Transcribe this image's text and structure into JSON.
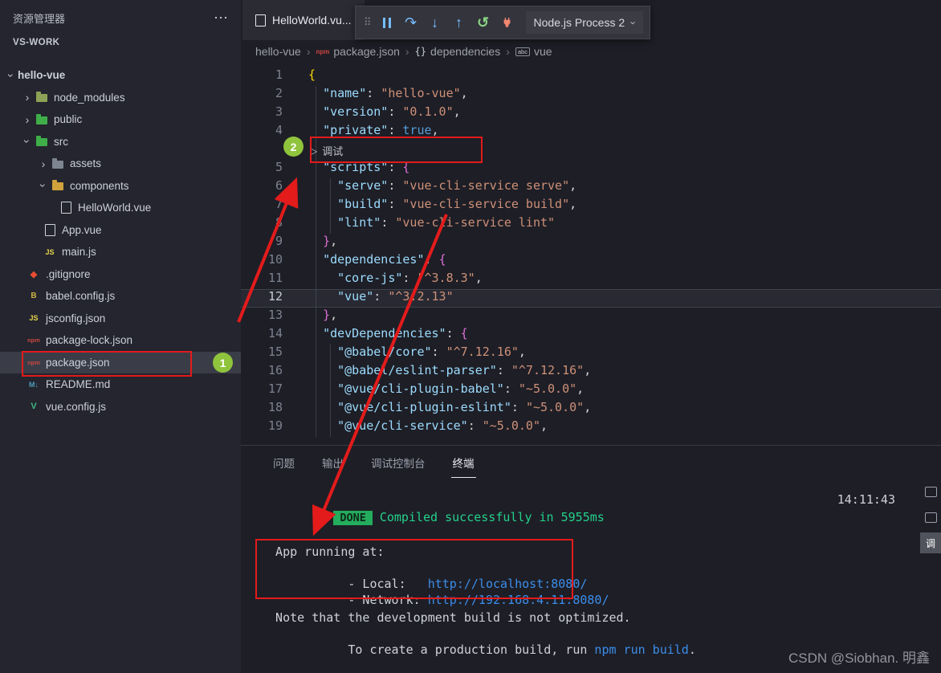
{
  "app": {
    "watermark": "CSDN @Siobhan. 明鑫"
  },
  "colors": {
    "annotationRed": "#e31b1b",
    "badgeGreen": "#8fc43c",
    "doneBg": "#23ad5c",
    "successGreen": "#23d18b",
    "linkBlue": "#3b8eea",
    "keyBlue": "#9cdcfe",
    "strOrange": "#ce9178",
    "kwBlue": "#569cd6",
    "braceGold": "#ffd700",
    "bracePurple": "#da70d6"
  },
  "sidebar": {
    "title": "资源管理器",
    "section": "VS-WORK",
    "tree": [
      {
        "label": "hello-vue",
        "level": 0,
        "chevron": "down"
      },
      {
        "label": "node_modules",
        "level": 1,
        "chevron": "right",
        "icon": "folder-nm"
      },
      {
        "label": "public",
        "level": 1,
        "chevron": "right",
        "icon": "folder-green"
      },
      {
        "label": "src",
        "level": 1,
        "chevron": "down",
        "icon": "folder-green"
      },
      {
        "label": "assets",
        "level": 2,
        "chevron": "right",
        "icon": "folder-gray"
      },
      {
        "label": "components",
        "level": 2,
        "chevron": "down",
        "icon": "folder-yellow"
      },
      {
        "label": "HelloWorld.vue",
        "level": 3,
        "icon": "page"
      },
      {
        "label": "App.vue",
        "level": 2,
        "icon": "page"
      },
      {
        "label": "main.js",
        "level": 2,
        "icon": "js"
      },
      {
        "label": ".gitignore",
        "level": 1,
        "icon": "git"
      },
      {
        "label": "babel.config.js",
        "level": 1,
        "icon": "babel"
      },
      {
        "label": "jsconfig.json",
        "level": 1,
        "icon": "js"
      },
      {
        "label": "package-lock.json",
        "level": 1,
        "icon": "npm"
      },
      {
        "label": "package.json",
        "level": 1,
        "icon": "npm",
        "selected": true
      },
      {
        "label": "README.md",
        "level": 1,
        "icon": "md"
      },
      {
        "label": "vue.config.js",
        "level": 1,
        "icon": "vue"
      }
    ]
  },
  "editor_tab": {
    "title": "HelloWorld.vu..."
  },
  "debug_toolbar": {
    "process_label": "Node.js Process 2",
    "icons": [
      "drag-handle",
      "pause",
      "step-over",
      "step-into",
      "step-out",
      "restart",
      "disconnect"
    ]
  },
  "breadcrumb": {
    "items": [
      {
        "label": "hello-vue"
      },
      {
        "label": "package.json",
        "icon": "npm"
      },
      {
        "label": "dependencies",
        "icon": "braces"
      },
      {
        "label": "vue",
        "icon": "abc"
      }
    ]
  },
  "editor": {
    "current_line": 12,
    "codelens": {
      "after_line": 4,
      "label": "调试"
    },
    "lines": [
      {
        "n": 1,
        "tokens": [
          [
            "{",
            "b1"
          ]
        ]
      },
      {
        "n": 2,
        "tokens": [
          [
            "  ",
            "p"
          ],
          [
            "\"name\"",
            "k"
          ],
          [
            ": ",
            "p"
          ],
          [
            "\"hello-vue\"",
            "s"
          ],
          [
            ",",
            "p"
          ]
        ]
      },
      {
        "n": 3,
        "tokens": [
          [
            "  ",
            "p"
          ],
          [
            "\"version\"",
            "k"
          ],
          [
            ": ",
            "p"
          ],
          [
            "\"0.1.0\"",
            "s"
          ],
          [
            ",",
            "p"
          ]
        ]
      },
      {
        "n": 4,
        "tokens": [
          [
            "  ",
            "p"
          ],
          [
            "\"private\"",
            "k"
          ],
          [
            ": ",
            "p"
          ],
          [
            "true",
            "w"
          ],
          [
            ",",
            "p"
          ]
        ]
      },
      {
        "n": 5,
        "tokens": [
          [
            "  ",
            "p"
          ],
          [
            "\"scripts\"",
            "k"
          ],
          [
            ": ",
            "p"
          ],
          [
            "{",
            "b2"
          ]
        ]
      },
      {
        "n": 6,
        "tokens": [
          [
            "    ",
            "p"
          ],
          [
            "\"serve\"",
            "k"
          ],
          [
            ": ",
            "p"
          ],
          [
            "\"vue-cli-service serve\"",
            "s"
          ],
          [
            ",",
            "p"
          ]
        ]
      },
      {
        "n": 7,
        "tokens": [
          [
            "    ",
            "p"
          ],
          [
            "\"build\"",
            "k"
          ],
          [
            ": ",
            "p"
          ],
          [
            "\"vue-cli-service build\"",
            "s"
          ],
          [
            ",",
            "p"
          ]
        ]
      },
      {
        "n": 8,
        "tokens": [
          [
            "    ",
            "p"
          ],
          [
            "\"lint\"",
            "k"
          ],
          [
            ": ",
            "p"
          ],
          [
            "\"vue-cli-service lint\"",
            "s"
          ]
        ]
      },
      {
        "n": 9,
        "tokens": [
          [
            "  ",
            "p"
          ],
          [
            "}",
            "b2"
          ],
          [
            ",",
            "p"
          ]
        ]
      },
      {
        "n": 10,
        "tokens": [
          [
            "  ",
            "p"
          ],
          [
            "\"dependencies\"",
            "k"
          ],
          [
            ": ",
            "p"
          ],
          [
            "{",
            "b2"
          ]
        ]
      },
      {
        "n": 11,
        "tokens": [
          [
            "    ",
            "p"
          ],
          [
            "\"core-js\"",
            "k"
          ],
          [
            ": ",
            "p"
          ],
          [
            "\"^3.8.3\"",
            "s"
          ],
          [
            ",",
            "p"
          ]
        ]
      },
      {
        "n": 12,
        "tokens": [
          [
            "    ",
            "p"
          ],
          [
            "\"vue\"",
            "k"
          ],
          [
            ": ",
            "p"
          ],
          [
            "\"^3.2.13\"",
            "s"
          ]
        ]
      },
      {
        "n": 13,
        "tokens": [
          [
            "  ",
            "p"
          ],
          [
            "}",
            "b2"
          ],
          [
            ",",
            "p"
          ]
        ]
      },
      {
        "n": 14,
        "tokens": [
          [
            "  ",
            "p"
          ],
          [
            "\"devDependencies\"",
            "k"
          ],
          [
            ": ",
            "p"
          ],
          [
            "{",
            "b2"
          ]
        ]
      },
      {
        "n": 15,
        "tokens": [
          [
            "    ",
            "p"
          ],
          [
            "\"@babel/core\"",
            "k"
          ],
          [
            ": ",
            "p"
          ],
          [
            "\"^7.12.16\"",
            "s"
          ],
          [
            ",",
            "p"
          ]
        ]
      },
      {
        "n": 16,
        "tokens": [
          [
            "    ",
            "p"
          ],
          [
            "\"@babel/eslint-parser\"",
            "k"
          ],
          [
            ": ",
            "p"
          ],
          [
            "\"^7.12.16\"",
            "s"
          ],
          [
            ",",
            "p"
          ]
        ]
      },
      {
        "n": 17,
        "tokens": [
          [
            "    ",
            "p"
          ],
          [
            "\"@vue/cli-plugin-babel\"",
            "k"
          ],
          [
            ": ",
            "p"
          ],
          [
            "\"~5.0.0\"",
            "s"
          ],
          [
            ",",
            "p"
          ]
        ]
      },
      {
        "n": 18,
        "tokens": [
          [
            "    ",
            "p"
          ],
          [
            "\"@vue/cli-plugin-eslint\"",
            "k"
          ],
          [
            ": ",
            "p"
          ],
          [
            "\"~5.0.0\"",
            "s"
          ],
          [
            ",",
            "p"
          ]
        ]
      },
      {
        "n": 19,
        "tokens": [
          [
            "    ",
            "p"
          ],
          [
            "\"@vue/cli-service\"",
            "k"
          ],
          [
            ": ",
            "p"
          ],
          [
            "\"~5.0.0\"",
            "s"
          ],
          [
            ",",
            "p"
          ]
        ]
      }
    ]
  },
  "panel": {
    "tabs": [
      {
        "label": "问题"
      },
      {
        "label": "输出"
      },
      {
        "label": "调试控制台"
      },
      {
        "label": "终端",
        "active": true
      }
    ]
  },
  "terminal": {
    "done_badge": "DONE",
    "compiled_text": "Compiled successfully in 5955ms",
    "time": "14:11:43",
    "app_running": "  App running at:",
    "local_label": "  - Local:   ",
    "local_url": "http://localhost:8080/",
    "network_label": "  - Network: ",
    "network_url": "http://192.168.4.11:8080/",
    "note_line1": "  Note that the development build is not optimized.",
    "note_line2_prefix": "  To create a production build, run ",
    "note_line2_cmd": "npm run build",
    "note_line2_suffix": "."
  },
  "terminal_list": {
    "items": [
      {
        "icon": "terminal"
      },
      {
        "icon": "terminal"
      },
      {
        "icon": "terminal",
        "active": true,
        "label": "调"
      }
    ]
  },
  "annotations": {
    "badge1": "1",
    "badge2": "2"
  }
}
